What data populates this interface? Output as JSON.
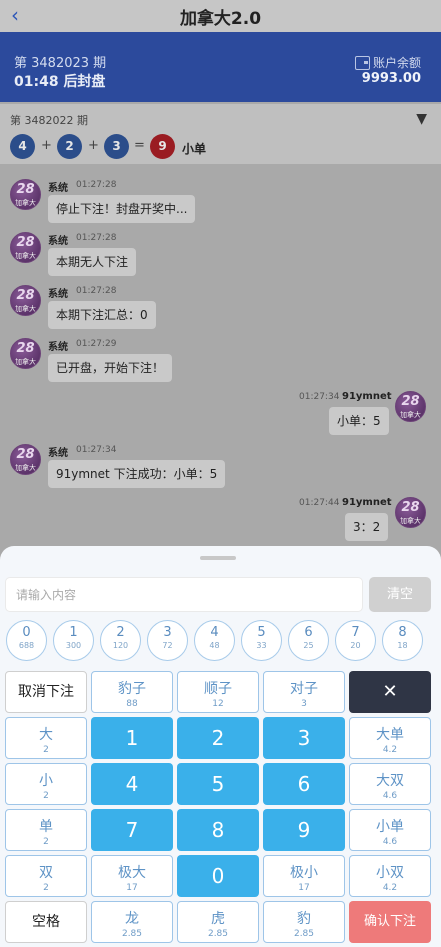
{
  "header": {
    "back_icon": "chevron-left-icon",
    "back_glyph": "‹",
    "title": "加拿大2.0"
  },
  "issue_bar": {
    "issue": "第 3482023 期",
    "countdown": "01:48 后封盘",
    "balance_label": "账户余额",
    "balance": "9993.00",
    "wallet_icon": "wallet-icon"
  },
  "last_result": {
    "issue": "第 3482022 期",
    "toggle_glyph": "▼",
    "balls": [
      "4",
      "2",
      "3"
    ],
    "plus": "+",
    "equals": "=",
    "sum": "9",
    "result": "小单"
  },
  "avatar_text": {
    "big": "28",
    "small": "加拿大"
  },
  "messages": [
    {
      "sender": "系统",
      "time": "01:27:28",
      "text": "停止下注！封盘开奖中..."
    },
    {
      "sender": "系统",
      "time": "01:27:28",
      "text": "本期无人下注"
    },
    {
      "sender": "系统",
      "time": "01:27:28",
      "text": "本期下注汇总：0"
    },
    {
      "sender": "系统",
      "time": "01:27:29",
      "text": "已开盘，开始下注！"
    },
    {
      "sender": "91ymnet",
      "time": "01:27:34",
      "text": "小单：5"
    },
    {
      "sender": "系统",
      "time": "01:27:34",
      "text": "91ymnet 下注成功：小单：5"
    },
    {
      "sender": "91ymnet",
      "time": "01:27:44",
      "text": "3：2"
    }
  ],
  "bet_panel": {
    "input_placeholder": "请输入内容",
    "clear_label": "清空",
    "numbers": [
      {
        "n": "0",
        "odds": "688"
      },
      {
        "n": "1",
        "odds": "300"
      },
      {
        "n": "2",
        "odds": "120"
      },
      {
        "n": "3",
        "odds": "72"
      },
      {
        "n": "4",
        "odds": "48"
      },
      {
        "n": "5",
        "odds": "33"
      },
      {
        "n": "6",
        "odds": "25"
      },
      {
        "n": "7",
        "odds": "20"
      },
      {
        "n": "8",
        "odds": "18"
      }
    ],
    "keys": {
      "cancel": "取消下注",
      "leopard": {
        "label": "豹子",
        "odds": "88"
      },
      "straight": {
        "label": "顺子",
        "odds": "12"
      },
      "pair": {
        "label": "对子",
        "odds": "3"
      },
      "delete_glyph": "✕",
      "big": {
        "label": "大",
        "odds": "2"
      },
      "small": {
        "label": "小",
        "odds": "2"
      },
      "odd": {
        "label": "单",
        "odds": "2"
      },
      "even": {
        "label": "双",
        "odds": "2"
      },
      "big_odd": {
        "label": "大单",
        "odds": "4.2"
      },
      "big_even": {
        "label": "大双",
        "odds": "4.6"
      },
      "small_odd": {
        "label": "小单",
        "odds": "4.6"
      },
      "small_even": {
        "label": "小双",
        "odds": "4.2"
      },
      "max": {
        "label": "极大",
        "odds": "17"
      },
      "min": {
        "label": "极小",
        "odds": "17"
      },
      "dragon": {
        "label": "龙",
        "odds": "2.85"
      },
      "tiger": {
        "label": "虎",
        "odds": "2.85"
      },
      "leopard2": {
        "label": "豹",
        "odds": "2.85"
      },
      "space": "空格",
      "confirm": "确认下注",
      "digits": [
        "1",
        "2",
        "3",
        "4",
        "5",
        "6",
        "7",
        "8",
        "9",
        "0"
      ]
    }
  }
}
